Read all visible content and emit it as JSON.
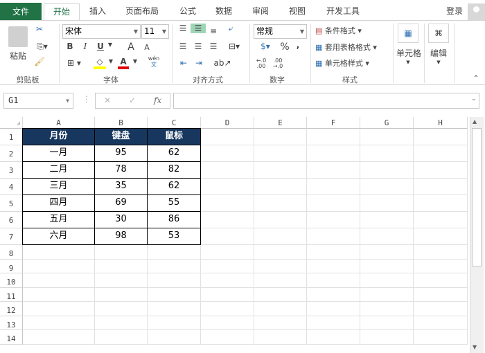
{
  "tabs": {
    "file": "文件",
    "home": "开始",
    "insert": "插入",
    "page_layout": "页面布局",
    "formulas": "公式",
    "data": "数据",
    "review": "审阅",
    "view": "视图",
    "developer": "开发工具",
    "login": "登录"
  },
  "ribbon": {
    "clipboard": {
      "paste": "粘贴",
      "label": "剪贴板"
    },
    "font": {
      "name": "宋体",
      "size": "11",
      "bold": "B",
      "italic": "I",
      "underline": "U",
      "grow": "A",
      "shrink": "A",
      "phonetic_top": "wén",
      "phonetic_bottom": "文",
      "label": "字体",
      "fill_color": "#ffff00",
      "font_color": "#e00000"
    },
    "alignment": {
      "label": "对齐方式"
    },
    "number": {
      "format": "常规",
      "percent": "%",
      "comma": ",",
      "inc_decimal": ".0\n.00",
      "label": "数字"
    },
    "styles": {
      "conditional": "条件格式",
      "table": "套用表格格式",
      "cell_styles": "单元格样式",
      "label": "样式"
    },
    "cells": {
      "label": "单元格"
    },
    "editing": {
      "label": "编辑"
    }
  },
  "formula_bar": {
    "name_box": "G1",
    "cancel": "✕",
    "enter": "✓",
    "fx": "fx",
    "value": ""
  },
  "columns": [
    "A",
    "B",
    "C",
    "D",
    "E",
    "F",
    "G",
    "H"
  ],
  "rows": [
    "1",
    "2",
    "3",
    "4",
    "5",
    "6",
    "7",
    "8",
    "9",
    "10",
    "11",
    "12",
    "13",
    "14"
  ],
  "table": {
    "header": [
      "月份",
      "键盘",
      "鼠标"
    ],
    "rows": [
      [
        "一月",
        "95",
        "62"
      ],
      [
        "二月",
        "78",
        "82"
      ],
      [
        "三月",
        "35",
        "62"
      ],
      [
        "四月",
        "69",
        "55"
      ],
      [
        "五月",
        "30",
        "86"
      ],
      [
        "六月",
        "98",
        "53"
      ]
    ],
    "header_color": "#17375e"
  }
}
